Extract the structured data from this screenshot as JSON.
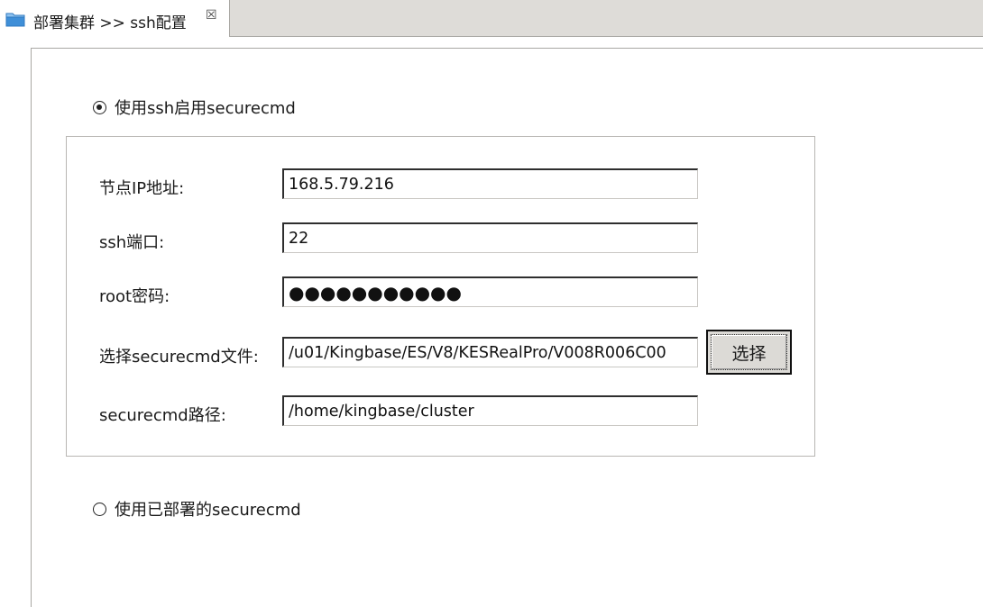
{
  "tab": {
    "icon": "folder-icon",
    "label": "部署集群 >> ssh配置",
    "close_glyph": "☒"
  },
  "options": {
    "ssh_radio_label": "使用ssh启用securecmd",
    "ssh_radio_checked": true,
    "deployed_radio_label": "使用已部署的securecmd",
    "deployed_radio_checked": false
  },
  "form": {
    "node_ip_label": "节点IP地址:",
    "node_ip_value": "168.5.79.216",
    "ssh_port_label": "ssh端口:",
    "ssh_port_value": "22",
    "root_password_label": "root密码:",
    "root_password_masked": "●●●●●●●●●●●",
    "securecmd_file_label": "选择securecmd文件:",
    "securecmd_file_value": "/u01/Kingbase/ES/V8/KESRealPro/V008R006C00",
    "choose_button_label": "选择",
    "securecmd_path_label": "securecmd路径:",
    "securecmd_path_value": "/home/kingbase/cluster"
  },
  "colors": {
    "tabbar_bg": "#dedcd8",
    "folder_blue": "#3f8fd8"
  }
}
